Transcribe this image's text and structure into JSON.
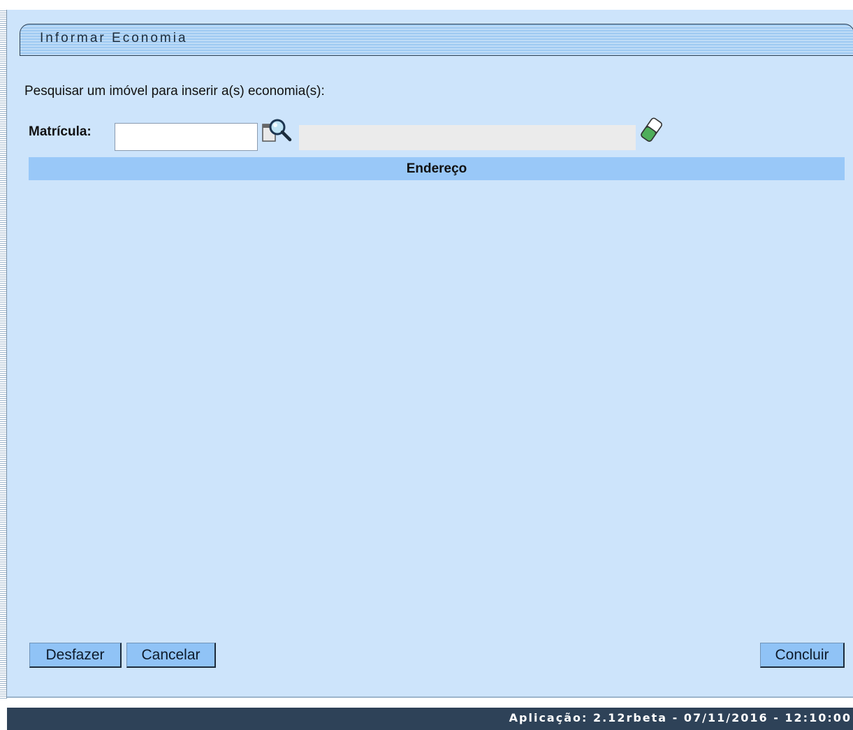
{
  "window": {
    "title": "Informar Economia"
  },
  "form": {
    "prompt": "Pesquisar um imóvel para inserir a(s) economia(s):",
    "matricula_label": "Matrícula:",
    "matricula_value": "",
    "description_value": ""
  },
  "table": {
    "columns": [
      "Endereço"
    ]
  },
  "buttons": {
    "undo": "Desfazer",
    "cancel": "Cancelar",
    "finish": "Concluir"
  },
  "icons": {
    "search": "search-icon",
    "clear": "eraser-icon"
  },
  "footer": {
    "text": "Aplicação: 2.12rbeta - 07/11/2016 - 12:10:00"
  }
}
